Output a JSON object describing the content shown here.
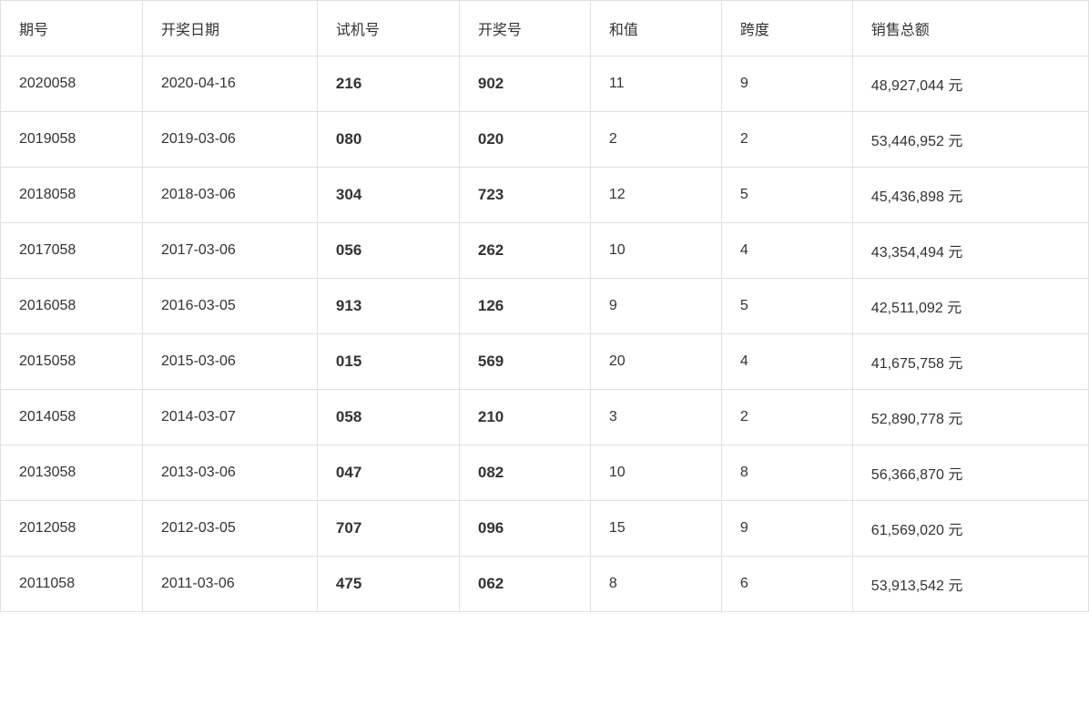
{
  "table": {
    "headers": [
      "期号",
      "开奖日期",
      "试机号",
      "开奖号",
      "和值",
      "跨度",
      "销售总额"
    ],
    "rows": [
      {
        "qihao": "2020058",
        "date": "2020-04-16",
        "shiji": "216",
        "kaijang": "902",
        "hezhi": "11",
        "kuadu": "9",
        "xiaoshou": "48,927,044 元"
      },
      {
        "qihao": "2019058",
        "date": "2019-03-06",
        "shiji": "080",
        "kaijang": "020",
        "hezhi": "2",
        "kuadu": "2",
        "xiaoshou": "53,446,952 元"
      },
      {
        "qihao": "2018058",
        "date": "2018-03-06",
        "shiji": "304",
        "kaijang": "723",
        "hezhi": "12",
        "kuadu": "5",
        "xiaoshou": "45,436,898 元"
      },
      {
        "qihao": "2017058",
        "date": "2017-03-06",
        "shiji": "056",
        "kaijang": "262",
        "hezhi": "10",
        "kuadu": "4",
        "xiaoshou": "43,354,494 元"
      },
      {
        "qihao": "2016058",
        "date": "2016-03-05",
        "shiji": "913",
        "kaijang": "126",
        "hezhi": "9",
        "kuadu": "5",
        "xiaoshou": "42,511,092 元"
      },
      {
        "qihao": "2015058",
        "date": "2015-03-06",
        "shiji": "015",
        "kaijang": "569",
        "hezhi": "20",
        "kuadu": "4",
        "xiaoshou": "41,675,758 元"
      },
      {
        "qihao": "2014058",
        "date": "2014-03-07",
        "shiji": "058",
        "kaijang": "210",
        "hezhi": "3",
        "kuadu": "2",
        "xiaoshou": "52,890,778 元"
      },
      {
        "qihao": "2013058",
        "date": "2013-03-06",
        "shiji": "047",
        "kaijang": "082",
        "hezhi": "10",
        "kuadu": "8",
        "xiaoshou": "56,366,870 元"
      },
      {
        "qihao": "2012058",
        "date": "2012-03-05",
        "shiji": "707",
        "kaijang": "096",
        "hezhi": "15",
        "kuadu": "9",
        "xiaoshou": "61,569,020 元"
      },
      {
        "qihao": "2011058",
        "date": "2011-03-06",
        "shiji": "475",
        "kaijang": "062",
        "hezhi": "8",
        "kuadu": "6",
        "xiaoshou": "53,913,542 元"
      }
    ]
  }
}
